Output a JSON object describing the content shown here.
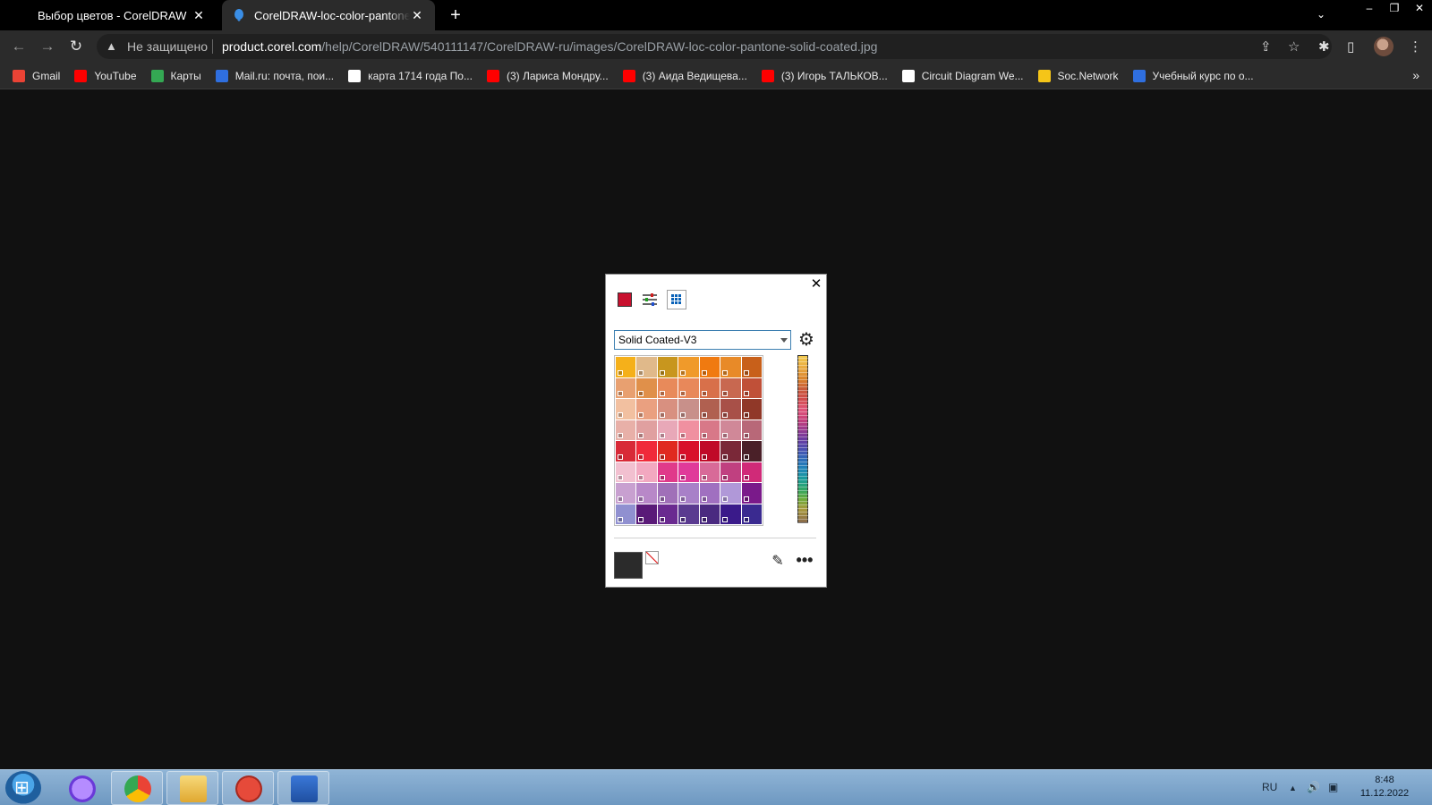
{
  "browser": {
    "tabs": [
      {
        "title": "Выбор цветов - CorelDRAW",
        "close": "✕"
      },
      {
        "title": "CorelDRAW-loc-color-pantone-solid-coated.jpg",
        "close": "✕"
      }
    ],
    "new_tab": "+",
    "tab_search": "⌄",
    "window_controls": {
      "minimize": "–",
      "restore": "❐",
      "close": "✕"
    },
    "nav": {
      "back": "←",
      "forward": "→",
      "reload": "↻"
    },
    "omnibox": {
      "warning_icon": "▲",
      "security_label": "Не защищено",
      "url_host": "product.corel.com",
      "url_path": "/help/CorelDRAW/540111147/CorelDRAW-ru/images/CorelDRAW-loc-color-pantone-solid-coated.jpg"
    },
    "toolbar_icons": {
      "share": "⇪",
      "star": "☆",
      "extensions": "✱",
      "sidepanel": "▯",
      "menu": "⋮"
    },
    "bookmarks": [
      {
        "label": "Gmail",
        "color": "#ea4335"
      },
      {
        "label": "YouTube",
        "color": "#ff0000"
      },
      {
        "label": "Карты",
        "color": "#34a853"
      },
      {
        "label": "Mail.ru: почта, пои...",
        "color": "#2f6fe0"
      },
      {
        "label": "карта 1714 года По...",
        "color": "#ffffff"
      },
      {
        "label": "(3) Лариса Мондру...",
        "color": "#ff0000"
      },
      {
        "label": "(3) Аида Ведищева...",
        "color": "#ff0000"
      },
      {
        "label": "(3) Игорь ТАЛЬКОВ...",
        "color": "#ff0000"
      },
      {
        "label": "Circuit Diagram We...",
        "color": "#ffffff"
      },
      {
        "label": "Soc.Network",
        "color": "#f5c518"
      },
      {
        "label": "Учебный курс по о...",
        "color": "#2f6fe0"
      }
    ],
    "bookmarks_more": "»"
  },
  "docker": {
    "close": "✕",
    "palette_select": "Solid Coated-V3",
    "gear": "⚙",
    "eyedropper": "✎",
    "more": "•••",
    "current_color": "#2b2b2b",
    "swatches": [
      "#f5b01a",
      "#e0b98a",
      "#c8961e",
      "#f09a2a",
      "#f07a10",
      "#e88a28",
      "#c8601a",
      "#e8a070",
      "#e0904a",
      "#e88a5a",
      "#e8885a",
      "#d8704a",
      "#c86850",
      "#c05038",
      "#f2c0a0",
      "#eaa080",
      "#d89080",
      "#c8908a",
      "#b06050",
      "#a85048",
      "#903828",
      "#e8b0a8",
      "#e0a0a0",
      "#e8a8b8",
      "#f090a0",
      "#d87888",
      "#d08898",
      "#b86878",
      "#d82a38",
      "#f02a3a",
      "#e02a20",
      "#d8102a",
      "#c00a28",
      "#7a2838",
      "#4a2028",
      "#f2c0d0",
      "#f2a8c0",
      "#e03a8a",
      "#e03a9a",
      "#d86a98",
      "#c04080",
      "#d02a78",
      "#c8a0d0",
      "#b888c8",
      "#a070b8",
      "#a880c8",
      "#a070c0",
      "#b098d8",
      "#7a1a8a",
      "#9090d0",
      "#5a1a78",
      "#6a2a90",
      "#5a3a90",
      "#4a2a80",
      "#3a1a8a",
      "#3a2a90"
    ]
  },
  "taskbar": {
    "language": "RU",
    "tray_arrow": "▲",
    "volume": "🔊",
    "network": "▣",
    "time": "8:48",
    "date": "11.12.2022"
  }
}
